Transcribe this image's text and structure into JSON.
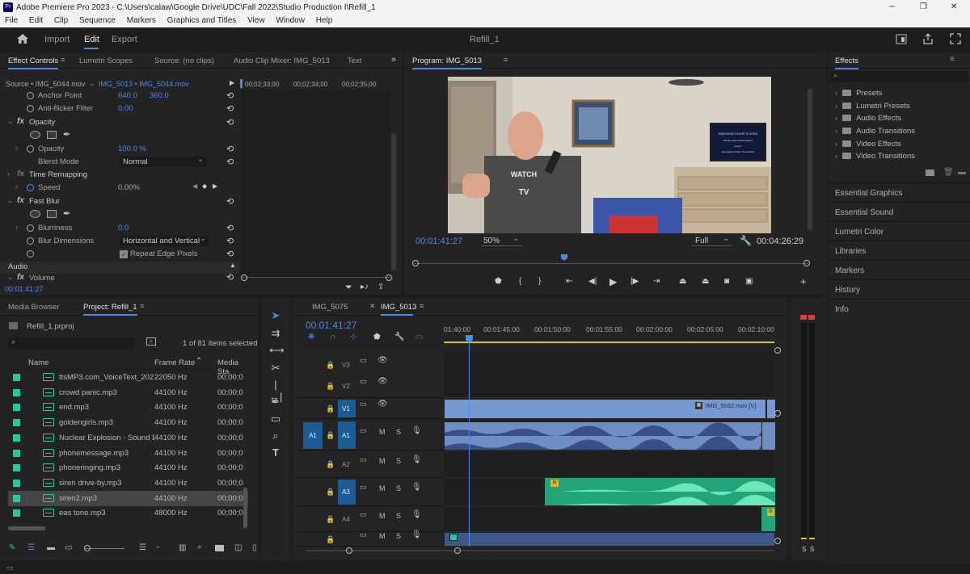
{
  "window": {
    "title": "Adobe Premiere Pro 2023 - C:\\Users\\calaw\\Google Drive\\UDC\\Fall 2022\\Studio Production I\\Refill_1",
    "app_badge": "Pr",
    "minimize": "─",
    "maximize": "❐",
    "close": "✕"
  },
  "menu": [
    "File",
    "Edit",
    "Clip",
    "Sequence",
    "Markers",
    "Graphics and Titles",
    "View",
    "Window",
    "Help"
  ],
  "workspace": {
    "tabs": [
      "Import",
      "Edit",
      "Export"
    ],
    "active_tab": "Edit",
    "project_name": "Refill_1"
  },
  "effect_controls": {
    "tabs": [
      "Effect Controls",
      "Lumetri Scopes",
      "Source: (no clips)",
      "Audio Clip Mixer: IMG_5013",
      "Text"
    ],
    "source_label": "Source • IMG_5044.mov",
    "clip_label": "IMG_5013 • IMG_5044.mov",
    "timecodes": [
      "00;02;33;00",
      "00;02;34;00",
      "00;02;35;00"
    ],
    "rows": {
      "anchor_point": {
        "label": "Anchor Point",
        "v1": "640.0",
        "v2": "360.0"
      },
      "anti_flicker": {
        "label": "Anti-flicker Filter",
        "value": "0.00"
      },
      "opacity_group": "Opacity",
      "opacity": {
        "label": "Opacity",
        "value": "100.0 %"
      },
      "blend_mode": {
        "label": "Blend Mode",
        "value": "Normal"
      },
      "time_remapping": "Time Remapping",
      "speed": {
        "label": "Speed",
        "value": "0.00%"
      },
      "fast_blur": "Fast Blur",
      "blurriness": {
        "label": "Blurriness",
        "value": "0.0"
      },
      "blur_dimensions": {
        "label": "Blur Dimensions",
        "value": "Horizontal and Vertical"
      },
      "repeat_edge": "Repeat Edge Pixels",
      "audio": "Audio",
      "volume": "Volume"
    },
    "bottom_timecode": "00:01:41:27"
  },
  "program": {
    "title": "Program: IMG_5013",
    "timecode": "00:01:41:27",
    "zoom": "50%",
    "quality": "Full",
    "duration": "00:04:26:29",
    "tv_text": [
      "EMERGENCY ALERT SYSTEM",
      "Primary Entry Point System",
      "Level 1",
      "Emergency Action Termination"
    ],
    "shirt_text": [
      "WATCH",
      "TV"
    ]
  },
  "effects_panel": {
    "title": "Effects",
    "items": [
      "Presets",
      "Lumetri Presets",
      "Audio Effects",
      "Audio Transitions",
      "Video Effects",
      "Video Transitions"
    ],
    "side_panels": [
      "Essential Graphics",
      "Essential Sound",
      "Lumetri Color",
      "Libraries",
      "Markers",
      "History",
      "Info"
    ]
  },
  "project": {
    "tabs": [
      "Media Browser",
      "Project: Refill_1"
    ],
    "file": "Refill_1.prproj",
    "count": "1 of 81 items selected",
    "columns": [
      "Name",
      "Frame Rate",
      "Media Sta"
    ],
    "rows": [
      {
        "name": "ttsMP3.com_VoiceText_202",
        "rate": "22050 Hz",
        "media": "00;00;0"
      },
      {
        "name": "crowd panic.mp3",
        "rate": "44100 Hz",
        "media": "00;00;0"
      },
      {
        "name": "end.mp3",
        "rate": "44100 Hz",
        "media": "00;00;0"
      },
      {
        "name": "goldengirls.mp3",
        "rate": "44100 Hz",
        "media": "00;00;0"
      },
      {
        "name": "Nuclear Explosion - Sound E",
        "rate": "44100 Hz",
        "media": "00;00;0"
      },
      {
        "name": "phonemessage.mp3",
        "rate": "44100 Hz",
        "media": "00;00;0"
      },
      {
        "name": "phoneringing.mp3",
        "rate": "44100 Hz",
        "media": "00;00;0"
      },
      {
        "name": "siren drive-by.mp3",
        "rate": "44100 Hz",
        "media": "00;00;0"
      },
      {
        "name": "siren2.mp3",
        "rate": "44100 Hz",
        "media": "00;00;0"
      },
      {
        "name": "eas tone.mp3",
        "rate": "48000 Hz",
        "media": "00;00;0"
      }
    ]
  },
  "timeline": {
    "tabs": [
      "IMG_5075",
      "IMG_5013"
    ],
    "timecode": "00:01:41:27",
    "ruler": [
      "01:40:00",
      "00:01:45:00",
      "00:01:50:00",
      "00:01:55:00",
      "00:02:00:00",
      "00:02:05:00",
      "00:02:10:00"
    ],
    "tracks": [
      "V3",
      "V2",
      "V1",
      "A1",
      "A2",
      "A3",
      "A4"
    ],
    "source_patch": "A1",
    "m": "M",
    "s": "S",
    "clip_label": "IMG_5032.mov [V]",
    "fx_badge": "fx"
  },
  "meters": {
    "s1": "S",
    "s2": "S"
  },
  "colors": {
    "accent": "#4d8ae8",
    "audio_clip": "#22a57a",
    "video_clip": "#7699d4",
    "playhead": "#4d8ae8",
    "media_swatch": "#27c99a"
  }
}
